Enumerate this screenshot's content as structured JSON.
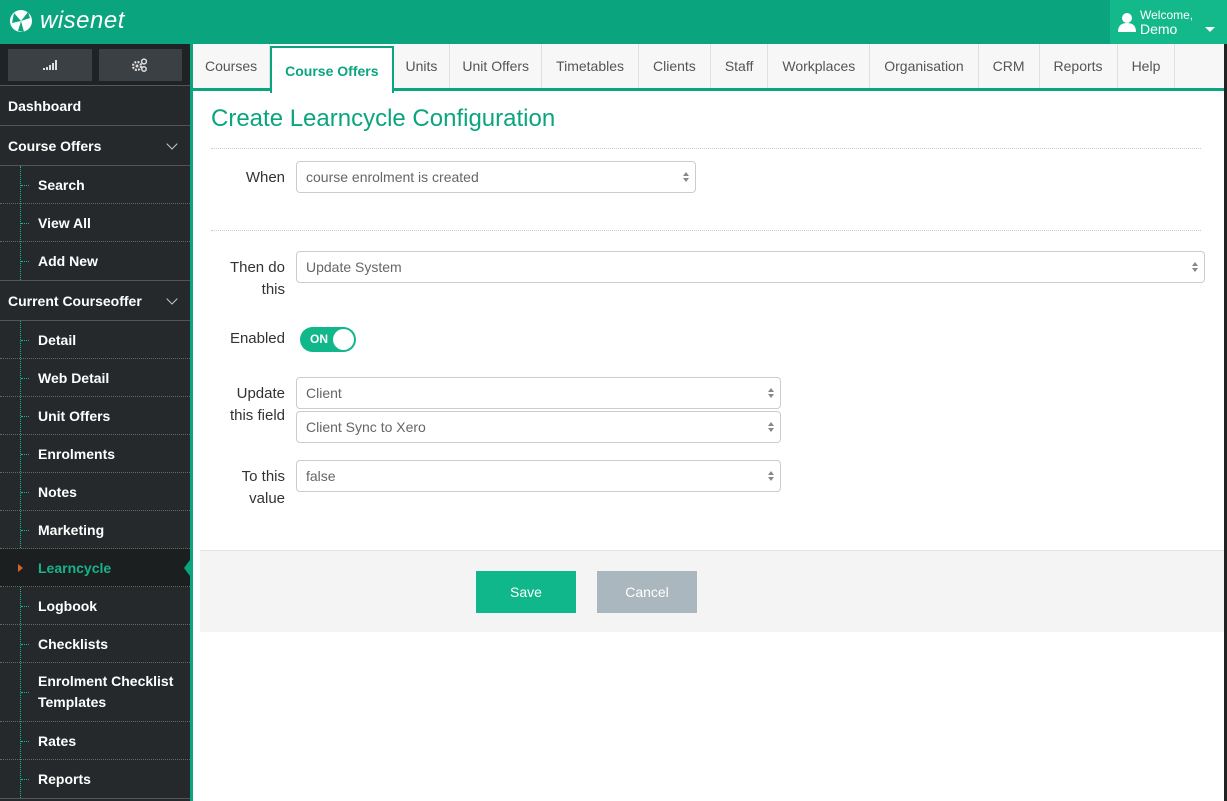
{
  "app": {
    "logo_text": "wisenet",
    "user": {
      "welcome": "Welcome,",
      "name": "Demo"
    }
  },
  "sidebar": {
    "tools": [
      {
        "icon": "signal-bars-icon"
      },
      {
        "icon": "gears-icon"
      }
    ],
    "dashboard": "Dashboard",
    "course_offers": {
      "label": "Course Offers",
      "items": [
        "Search",
        "View All",
        "Add New"
      ]
    },
    "current_courseoffer": {
      "label": "Current Courseoffer",
      "items": [
        "Detail",
        "Web Detail",
        "Unit Offers",
        "Enrolments",
        "Notes",
        "Marketing",
        "Learncycle",
        "Logbook",
        "Checklists",
        "Enrolment Checklist Templates",
        "Rates",
        "Reports"
      ],
      "active": "Learncycle"
    }
  },
  "tabs": {
    "items": [
      "Courses",
      "Course Offers",
      "Units",
      "Unit Offers",
      "Timetables",
      "Clients",
      "Staff",
      "Workplaces",
      "Organisation",
      "CRM",
      "Reports",
      "Help"
    ],
    "active": "Course Offers"
  },
  "form": {
    "title": "Create Learncycle Configuration",
    "when": {
      "label": "When",
      "value": "course enrolment is created"
    },
    "then": {
      "label_line1": "Then do",
      "label_line2": "this",
      "value": "Update System"
    },
    "enabled": {
      "label": "Enabled",
      "state": "ON",
      "on": true
    },
    "update_field": {
      "label_line1": "Update",
      "label_line2": "this field",
      "value1": "Client",
      "value2": "Client Sync to Xero"
    },
    "to_value": {
      "label_line1": "To this",
      "label_line2": "value",
      "value": "false"
    },
    "save_label": "Save",
    "cancel_label": "Cancel"
  },
  "colors": {
    "brand": "#0aa57f",
    "button_save": "#0fb78a",
    "button_cancel": "#aab7bf",
    "active_bullet": "#d9622b"
  }
}
